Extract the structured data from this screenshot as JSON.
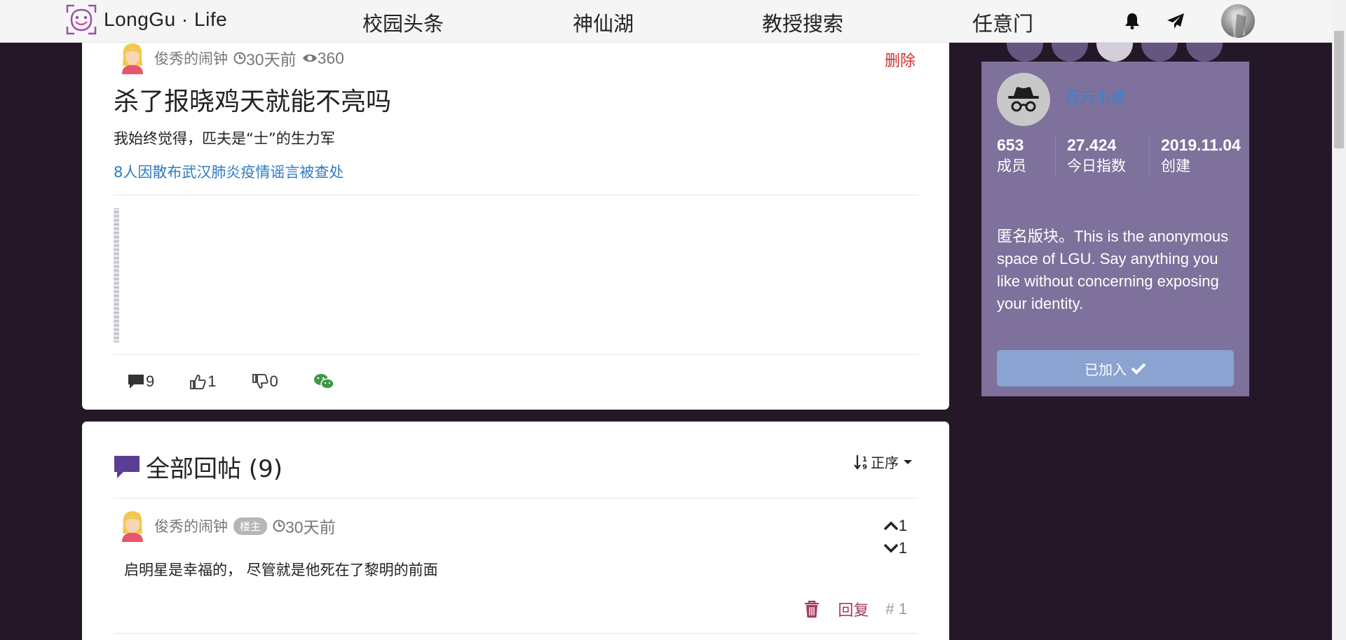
{
  "navbar": {
    "brand": "LongGu · Life",
    "links": [
      "校园头条",
      "神仙湖",
      "教授搜索",
      "任意门"
    ]
  },
  "post": {
    "author": "俊秀的闹钟",
    "time": "30天前",
    "views": "360",
    "delete_label": "删除",
    "title": "杀了报晓鸡天就能不亮吗",
    "body": "我始终觉得，匹夫是“士”的生力军",
    "link_text": "8人因散布武汉肺炎疫情谣言被查处",
    "comments": "9",
    "likes": "1",
    "dislikes": "0"
  },
  "replies": {
    "title": "全部回帖 (9)",
    "sort_label": "正序",
    "items": [
      {
        "author": "俊秀的闹钟",
        "badge": "楼主",
        "time": "30天前",
        "upvotes": "1",
        "downvotes": "1",
        "text": "启明星是幸福的， 尽管就是他死在了黎明的前面",
        "reply_label": "回复",
        "floor": "# 1"
      }
    ]
  },
  "sidebar": {
    "community_name": "百万小道",
    "stats": [
      {
        "value": "653",
        "label": "成员"
      },
      {
        "value": "27.424",
        "label": "今日指数"
      },
      {
        "value": "2019.11.04",
        "label": "创建"
      }
    ],
    "description": "匿名版块。This is the anonymous space of LGU. Say anything you like without concerning exposing your identity.",
    "join_label": "已加入"
  },
  "colors": {
    "background": "#241727",
    "sidebar": "#7e729c",
    "link": "#2f7cc2",
    "delete": "#d32f2f",
    "reply": "#a33a62",
    "join_button": "#8aa3d1"
  }
}
